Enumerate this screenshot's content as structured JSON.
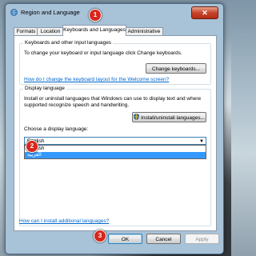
{
  "window": {
    "title": "Region and Language",
    "close_label": "✕"
  },
  "tabs": [
    {
      "label": "Formats"
    },
    {
      "label": "Location"
    },
    {
      "label": "Keyboards and Languages"
    },
    {
      "label": "Administrative"
    }
  ],
  "keyboards": {
    "title": "Keyboards and other input languages",
    "description": "To change your keyboard or input language click Change keyboards.",
    "change_button": "Change keyboards...",
    "welcome_link": "How do I change the keyboard layout for the Welcome screen?"
  },
  "display_language": {
    "title": "Display language",
    "description": "Install or uninstall languages that Windows can use to display text and where supported recognize speech and handwriting.",
    "install_button": "Install/uninstall languages...",
    "choose_label": "Choose a display language:",
    "selected": "English",
    "options": [
      "English",
      "العربية"
    ]
  },
  "footer": {
    "install_link": "How can I install additional languages?",
    "ok": "OK",
    "cancel": "Cancel",
    "apply": "Apply"
  },
  "badges": [
    "1",
    "2",
    "3"
  ],
  "colors": {
    "badge": "#d9261c",
    "selection": "#3399ff",
    "link": "#0066cc"
  },
  "icons": {
    "window": "globe-keyboard-icon",
    "install": "uac-shield-icon"
  }
}
